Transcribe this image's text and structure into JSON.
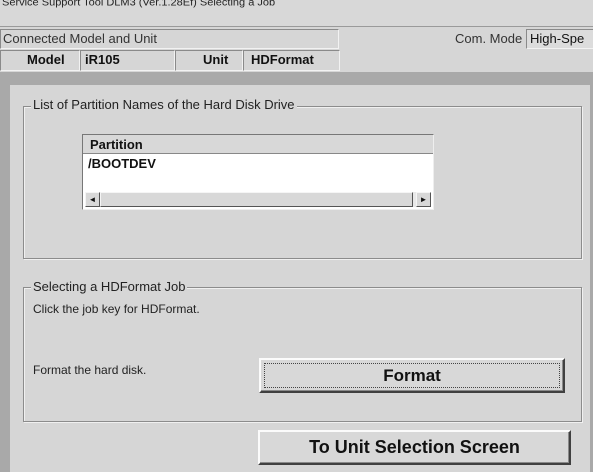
{
  "window": {
    "title": "Service Support Tool DLM3 (Ver.1.28Ef) Selecting a Job"
  },
  "header": {
    "connected_label": "Connected Model and Unit",
    "com_mode_label": "Com. Mode",
    "com_mode_value": "High-Spe",
    "model_label": "Model",
    "model_value": "iR105",
    "unit_label": "Unit",
    "unit_value": "HDFormat"
  },
  "partitions": {
    "group_title": "List of Partition Names of the Hard Disk Drive",
    "column_header": "Partition",
    "rows": [
      "/BOOTDEV"
    ],
    "scroll_left_icon": "◄",
    "scroll_right_icon": "►"
  },
  "job": {
    "group_title": "Selecting a HDFormat Job",
    "instruction": "Click the job key for HDFormat.",
    "format_description": "Format the hard disk.",
    "format_button": "Format"
  },
  "footer": {
    "unit_selection_button": "To Unit Selection Screen"
  }
}
